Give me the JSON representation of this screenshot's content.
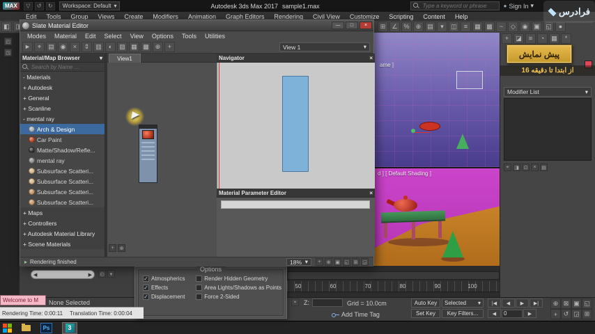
{
  "glyphs": {
    "dropdown": "▾",
    "status_arrow": "▸",
    "filter": "▼"
  },
  "titlebar": {
    "logo": "MAX",
    "workspace": "Workspace: Default",
    "app_title": "Autodesk 3ds Max 2017",
    "file_name": "sample1.max",
    "search_placeholder": "Type a keyword or phrase",
    "sign_in": "Sign In"
  },
  "menubar": {
    "items": [
      "Edit",
      "Tools",
      "Group",
      "Views",
      "Create",
      "Modifiers",
      "Animation",
      "Graph Editors",
      "Rendering",
      "Civil View",
      "Customize",
      "Scripting",
      "Content",
      "Help"
    ]
  },
  "main_toolbar": {
    "left_icons": [
      {
        "name": "select-and-link-icon",
        "glyph": "◧"
      },
      {
        "name": "unlink-selection-icon",
        "glyph": "◨"
      }
    ],
    "right_icons": [
      {
        "name": "snap-toggle-icon",
        "glyph": "⊞"
      },
      {
        "name": "angle-snap-icon",
        "glyph": "∠"
      },
      {
        "name": "percent-snap-icon",
        "glyph": "%"
      },
      {
        "name": "spinner-snap-icon",
        "glyph": "⊕"
      },
      {
        "name": "edit-named-selection-icon",
        "glyph": "▤"
      },
      {
        "name": "named-selection-dropdown-icon",
        "glyph": "▾"
      },
      {
        "name": "mirror-icon",
        "glyph": "◫"
      },
      {
        "name": "align-icon",
        "glyph": "≡"
      },
      {
        "name": "layer-manager-icon",
        "glyph": "▦"
      },
      {
        "name": "scene-explorer-icon",
        "glyph": "▩"
      },
      {
        "name": "curve-editor-icon",
        "glyph": "~"
      },
      {
        "name": "schematic-view-icon",
        "glyph": "◇"
      },
      {
        "name": "material-editor-icon",
        "glyph": "◉"
      },
      {
        "name": "render-setup-icon",
        "glyph": "▣"
      },
      {
        "name": "rendered-frame-icon",
        "glyph": "◱"
      },
      {
        "name": "render-production-icon",
        "glyph": "●"
      }
    ]
  },
  "slate": {
    "title": "Slate Material Editor",
    "buttons": {
      "minimize": "—",
      "maximize": "□",
      "close": "×"
    },
    "menus": [
      "Modes",
      "Material",
      "Edit",
      "Select",
      "View",
      "Options",
      "Tools",
      "Utilities"
    ],
    "toolbar_icons": [
      {
        "name": "select-tool-icon",
        "glyph": "►"
      },
      {
        "name": "pick-material-from-object-icon",
        "glyph": "⌖"
      },
      {
        "name": "put-to-library-icon",
        "glyph": "▤"
      },
      {
        "name": "assign-material-to-selection-icon",
        "glyph": "◉"
      },
      {
        "name": "delete-selected-icon",
        "glyph": "×"
      },
      {
        "name": "move-children-icon",
        "glyph": "⇕"
      },
      {
        "name": "hide-unused-nodeslots-icon",
        "glyph": "▥"
      },
      {
        "name": "show-shaded-material-icon",
        "glyph": "◐"
      },
      {
        "name": "show-background-icon",
        "glyph": "▨"
      },
      {
        "name": "layout-all-icon",
        "glyph": "▦"
      },
      {
        "name": "layout-children-icon",
        "glyph": "▩"
      },
      {
        "name": "zoom-tool-icon",
        "glyph": "⊕"
      },
      {
        "name": "pan-tool-icon",
        "glyph": "+"
      }
    ],
    "view_selector": "View 1",
    "browser": {
      "header": "Material/Map Browser",
      "search_placeholder": "Search by Name ...",
      "rows": [
        {
          "label": "- Materials",
          "type": "group"
        },
        {
          "label": "+ Autodesk",
          "type": "group"
        },
        {
          "label": "+ General",
          "type": "group"
        },
        {
          "label": "+ Scanline",
          "type": "group"
        },
        {
          "label": "- mental ray",
          "type": "group"
        },
        {
          "label": "Arch & Design",
          "type": "item",
          "selected": true,
          "swatch": "#a8b0b8"
        },
        {
          "label": "Car Paint",
          "type": "item",
          "swatch": "#c04a28"
        },
        {
          "label": "Matte/Shadow/Refle...",
          "type": "item",
          "swatch": "#303030"
        },
        {
          "label": "mental ray",
          "type": "item",
          "swatch": "#909090"
        },
        {
          "label": "Subsurface Scatteri...",
          "type": "item",
          "swatch": "#d8b88a"
        },
        {
          "label": "Subsurface Scatteri...",
          "type": "item",
          "swatch": "#d8b88a"
        },
        {
          "label": "Subsurface Scatteri...",
          "type": "item",
          "swatch": "#c89868"
        },
        {
          "label": "Subsurface Scatteri...",
          "type": "item",
          "swatch": "#c89868"
        },
        {
          "label": "+ Maps",
          "type": "group"
        },
        {
          "label": "+ Controllers",
          "type": "group"
        },
        {
          "label": "+ Autodesk Material Library",
          "type": "group"
        },
        {
          "label": "+ Scene Materials",
          "type": "group"
        }
      ]
    },
    "view_tab": "View1",
    "navigator": {
      "title": "Navigator"
    },
    "param_editor": {
      "title": "Material Parameter Editor"
    },
    "statusbar": {
      "message": "Rendering finished",
      "zoom": "18%",
      "icons": [
        {
          "name": "status-pan-icon",
          "glyph": "+"
        },
        {
          "name": "status-zoom-icon",
          "glyph": "⊕"
        },
        {
          "name": "status-zoom-extents-icon",
          "glyph": "▣"
        },
        {
          "name": "status-zoom-region-icon",
          "glyph": "◱"
        },
        {
          "name": "status-fit-view-icon",
          "glyph": "⊞"
        },
        {
          "name": "status-maximize-icon",
          "glyph": "◲"
        }
      ]
    }
  },
  "viewport": {
    "top_label": "ame ]",
    "camera_label": "d ] [ Default Shading ]"
  },
  "command_panel": {
    "modifier_list": "Modifier List",
    "tab_icons": [
      {
        "name": "create-tab-icon",
        "glyph": "+"
      },
      {
        "name": "modify-tab-icon",
        "glyph": "◪"
      },
      {
        "name": "hierarchy-tab-icon",
        "glyph": "≡"
      },
      {
        "name": "motion-tab-icon",
        "glyph": "◔"
      },
      {
        "name": "display-tab-icon",
        "glyph": "▦"
      },
      {
        "name": "utilities-tab-icon",
        "glyph": "*"
      }
    ],
    "stack_icons": [
      {
        "name": "pin-stack-icon",
        "glyph": "⌖"
      },
      {
        "name": "show-end-result-icon",
        "glyph": "◨"
      },
      {
        "name": "make-unique-icon",
        "glyph": "⊡"
      },
      {
        "name": "remove-modifier-icon",
        "glyph": "×"
      },
      {
        "name": "configure-modifier-sets-icon",
        "glyph": "▤"
      }
    ]
  },
  "render_options": {
    "title": "Options",
    "left": [
      {
        "label": "Atmospherics",
        "checked": true
      },
      {
        "label": "Effects",
        "checked": true
      },
      {
        "label": "Displacement",
        "checked": true
      }
    ],
    "right": [
      {
        "label": "Render Hidden Geometry",
        "checked": false
      },
      {
        "label": "Area Lights/Shadows as Points",
        "checked": false
      },
      {
        "label": "Force 2-Sided",
        "checked": false
      }
    ]
  },
  "timeline": {
    "ticks": [
      "50",
      "60",
      "70",
      "80",
      "90",
      "100"
    ]
  },
  "time_slider": {
    "left": "◀",
    "right": "▶"
  },
  "statusbar": {
    "selection": "None Selected",
    "z_label": "Z:",
    "grid": "Grid = 10.0cm",
    "add_time_tag": "Add Time Tag",
    "auto_key": "Auto Key",
    "set_key": "Set Key",
    "selection_set": "Selected",
    "key_filters": "Key Filters...",
    "frame_value": "0",
    "transport_row1": [
      {
        "name": "go-to-start-button",
        "glyph": "|◀"
      },
      {
        "name": "previous-key-button",
        "glyph": "◀"
      },
      {
        "name": "play-button",
        "glyph": "▶"
      },
      {
        "name": "go-to-end-button",
        "glyph": "▶|"
      }
    ],
    "prev_frame_glyph": "◀",
    "next_frame_glyph": "▶",
    "nav_icons": [
      {
        "name": "zoom-icon",
        "glyph": "⊕"
      },
      {
        "name": "zoom-all-icon",
        "glyph": "⊠"
      },
      {
        "name": "zoom-extents-icon",
        "glyph": "▣"
      },
      {
        "name": "zoom-region-icon",
        "glyph": "◱"
      },
      {
        "name": "pan-view-icon",
        "glyph": "+"
      },
      {
        "name": "orbit-icon",
        "glyph": "↺"
      },
      {
        "name": "maximize-viewport-icon",
        "glyph": "◲"
      },
      {
        "name": "grid-toggle-icon",
        "glyph": "⊞"
      }
    ]
  },
  "maxscript": {
    "welcome": "Welcome to M",
    "render_time": "Rendering Time: 0:00:11",
    "translation_time": "Translation Time: 0:00:04"
  },
  "overlay": {
    "brand": "فرادرس",
    "badge": "پیش نمایش",
    "subtitle": "از ابتدا تا دقیقه 16"
  },
  "taskbar": {
    "photoshop_label": "Ps",
    "max_label": "3"
  }
}
